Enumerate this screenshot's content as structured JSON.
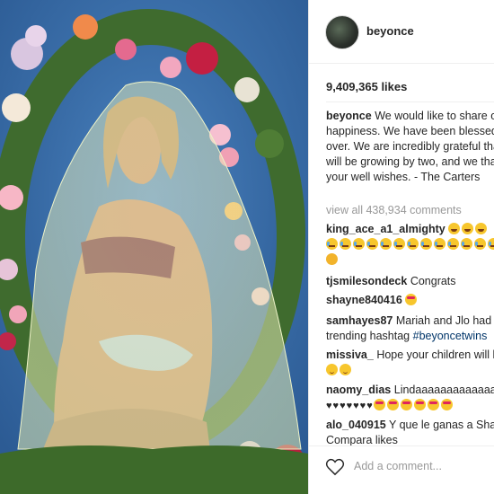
{
  "post": {
    "username": "beyonce",
    "likes": "9,409,365 likes",
    "caption_user": "beyonce",
    "caption_text": "We would like to share our love and happiness. We have been blessed two times over. We are incredibly grateful that our family will be growing by two, and we thank you for your well wishes. - The Carters",
    "view_all": "view all 438,934 comments"
  },
  "comments": [
    {
      "user": "king_ace_a1_almighty",
      "text": ""
    },
    {
      "user": "tjsmilesondeck",
      "text": "Congrats"
    },
    {
      "user": "shayne840416",
      "text": ""
    },
    {
      "user": "samhayes87",
      "text": "Mariah and Jlo had twins first ... trending hashtag",
      "tag": "#beyoncetwins"
    },
    {
      "user": "missiva_",
      "text": "Hope your children will look like Jay"
    },
    {
      "user": "naomy_dias",
      "text": "Lindaaaaaaaaaaaaaaa"
    },
    {
      "user": "alo_040915",
      "text": "Y que le ganas a Shakira Compara likes"
    }
  ],
  "footer": {
    "add_comment_placeholder": "Add a comment..."
  },
  "icons": {
    "like": "heart-outline-icon",
    "avatar": "profile-avatar"
  },
  "colors": {
    "link": "#003569",
    "muted": "#999999",
    "text": "#262626"
  }
}
